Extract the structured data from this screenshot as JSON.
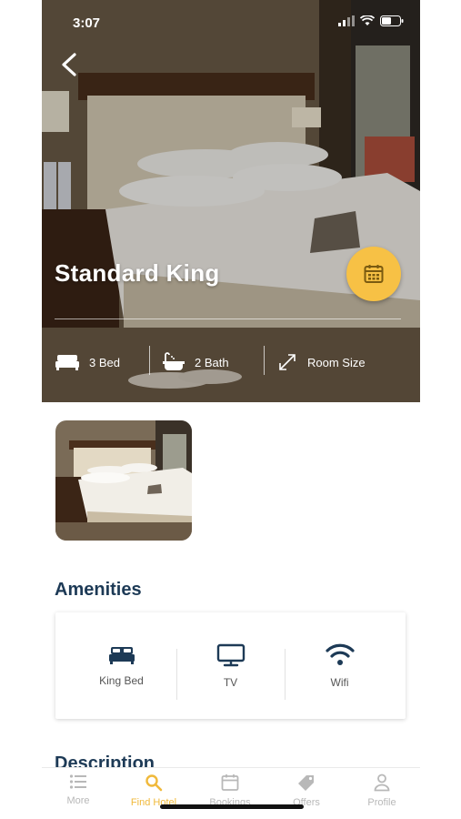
{
  "status": {
    "time": "3:07"
  },
  "room": {
    "name": "Standard King"
  },
  "specs": [
    {
      "icon": "bed-icon",
      "label": "3 Bed"
    },
    {
      "icon": "bath-icon",
      "label": "2 Bath"
    },
    {
      "icon": "resize-icon",
      "label": "Room Size"
    }
  ],
  "amenities": {
    "title": "Amenities",
    "items": [
      {
        "icon": "bed-icon",
        "label": "King Bed"
      },
      {
        "icon": "tv-icon",
        "label": "TV"
      },
      {
        "icon": "wifi-icon",
        "label": "Wifi"
      }
    ]
  },
  "description": {
    "title": "Description"
  },
  "nav": {
    "items": [
      {
        "icon": "list-icon",
        "label": "More"
      },
      {
        "icon": "search-icon",
        "label": "Find Hotel"
      },
      {
        "icon": "calendar-icon",
        "label": "Bookings"
      },
      {
        "icon": "tag-icon",
        "label": "Offers"
      },
      {
        "icon": "profile-icon",
        "label": "Profile"
      }
    ],
    "active": "Find Hotel"
  },
  "colors": {
    "accent": "#f7c145",
    "heading": "#1d3a56",
    "nav_active": "#f0b93b",
    "nav_inactive": "#b8b8b8"
  }
}
